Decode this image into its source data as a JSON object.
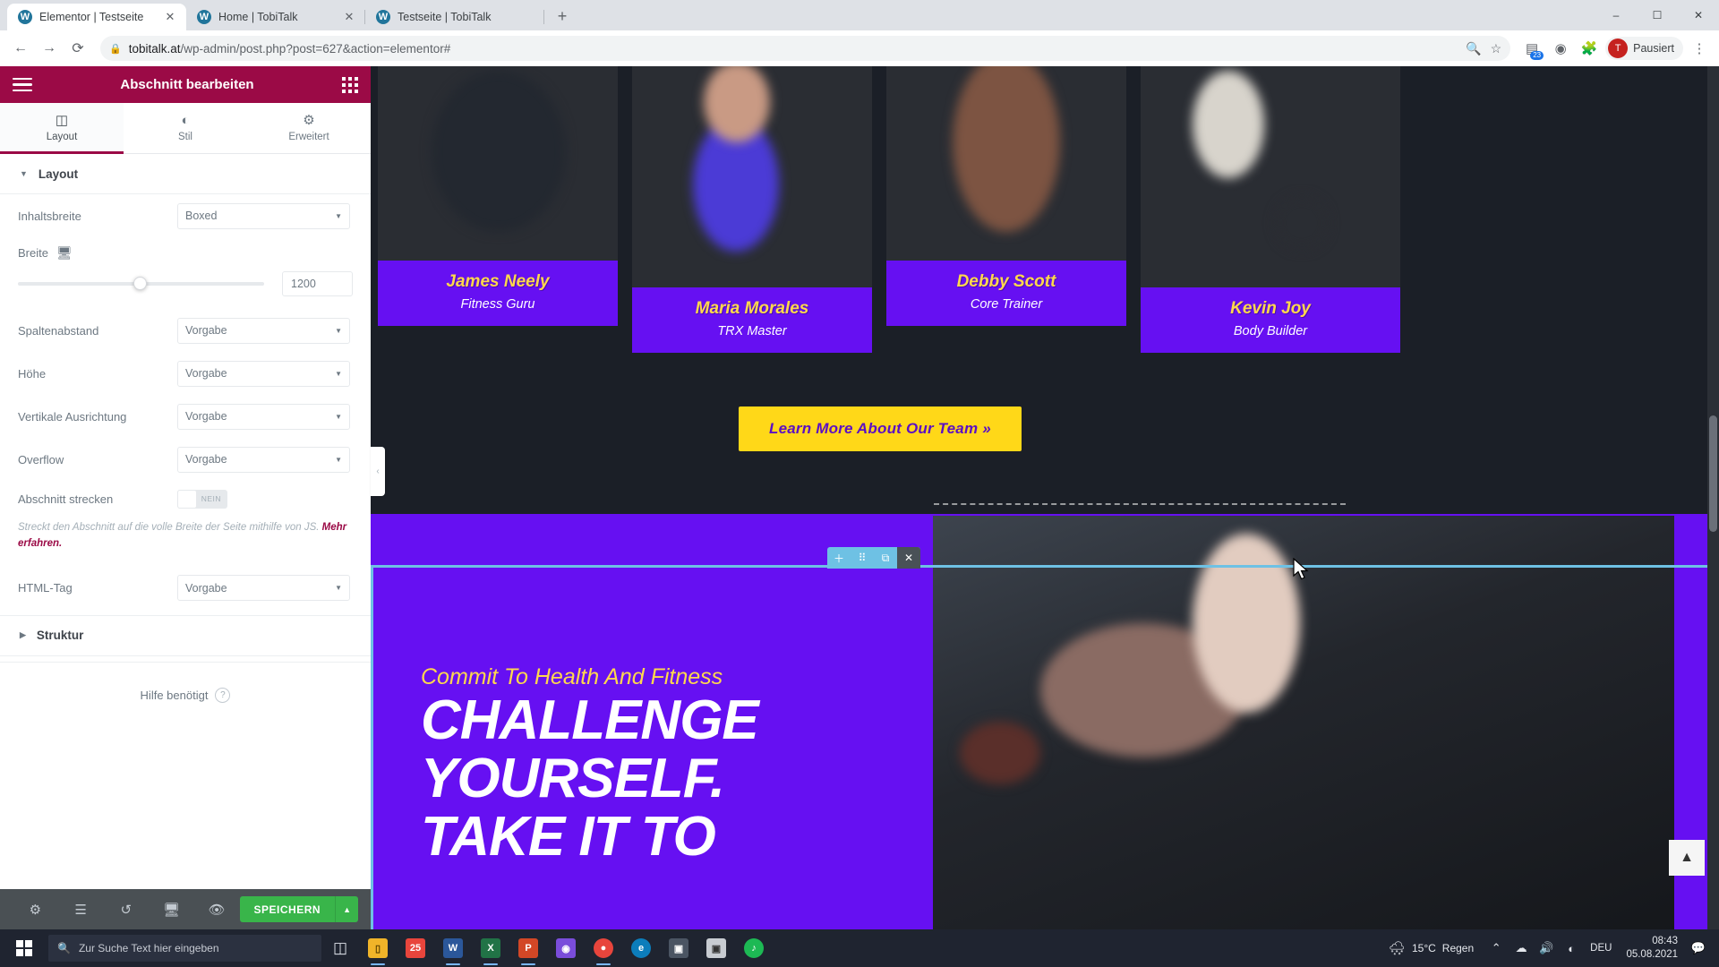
{
  "browser": {
    "tabs": [
      {
        "title": "Elementor | Testseite",
        "favicon": "wordpress-icon",
        "active": true,
        "closable": true
      },
      {
        "title": "Home | TobiTalk",
        "favicon": "wordpress-icon",
        "active": false,
        "closable": true
      },
      {
        "title": "Testseite | TobiTalk",
        "favicon": "wordpress-icon",
        "active": false,
        "closable": false
      }
    ],
    "new_tab_label": "+",
    "window_controls": {
      "minimize": "–",
      "maximize": "☐",
      "close": "✕"
    },
    "nav": {
      "back": "←",
      "forward": "→",
      "reload": "⟳"
    },
    "url_domain": "tobitalk.at",
    "url_path": "/wp-admin/post.php?post=627&action=elementor#",
    "lock_icon": "lock-icon",
    "zoom_icon": "zoom-icon",
    "bookmark_icon": "star-icon",
    "extension_badge": "23",
    "profile_label": "Pausiert",
    "profile_initial": "T",
    "menu_icon": "kebab-menu-icon"
  },
  "panel": {
    "title": "Abschnitt bearbeiten",
    "menu_icon": "hamburger-icon",
    "apps_icon": "grid-apps-icon",
    "tabs": [
      {
        "label": "Layout",
        "icon": "columns-icon",
        "active": true
      },
      {
        "label": "Stil",
        "icon": "contrast-icon",
        "active": false
      },
      {
        "label": "Erweitert",
        "icon": "gear-icon",
        "active": false
      }
    ],
    "section_layout": {
      "title": "Layout",
      "expanded": true,
      "controls": [
        {
          "type": "select",
          "label": "Inhaltsbreite",
          "value": "Boxed"
        },
        {
          "type": "slider",
          "label": "Breite",
          "device_icon": "desktop-icon",
          "value": "1200",
          "percent": 47
        },
        {
          "type": "select",
          "label": "Spaltenabstand",
          "value": "Vorgabe"
        },
        {
          "type": "select",
          "label": "Höhe",
          "value": "Vorgabe"
        },
        {
          "type": "select",
          "label": "Vertikale Ausrichtung",
          "value": "Vorgabe"
        },
        {
          "type": "select",
          "label": "Overflow",
          "value": "Vorgabe"
        },
        {
          "type": "toggle",
          "label": "Abschnitt strecken",
          "value": "NEIN"
        }
      ],
      "stretch_description": "Streckt den Abschnitt auf die volle Breite der Seite mithilfe von JS.",
      "stretch_link": "Mehr erfahren.",
      "html_tag": {
        "label": "HTML-Tag",
        "value": "Vorgabe"
      }
    },
    "section_struktur": {
      "title": "Struktur",
      "expanded": false
    },
    "help": {
      "text": "Hilfe benötigt",
      "icon": "question-circle-icon"
    },
    "footer": {
      "icons": [
        {
          "name": "settings-gear-icon"
        },
        {
          "name": "layers-navigator-icon"
        },
        {
          "name": "history-clock-icon"
        },
        {
          "name": "responsive-devices-icon"
        },
        {
          "name": "preview-eye-icon"
        }
      ],
      "save_label": "SPEICHERN",
      "save_caret": "▲",
      "save_color": "#39b54a"
    },
    "collapse_handle": "‹",
    "header_color": "#9b0a46"
  },
  "canvas": {
    "team_cards": [
      {
        "name": "James Neely",
        "role": "Fitness Guru"
      },
      {
        "name": "Maria Morales",
        "role": "TRX Master"
      },
      {
        "name": "Debby Scott",
        "role": "Core Trainer"
      },
      {
        "name": "Kevin Joy",
        "role": "Body Builder"
      }
    ],
    "cta_button": {
      "label": "Learn More About Our Team",
      "arrow": "»",
      "bg": "#ffd818",
      "fg": "#5b0fc4"
    },
    "hero": {
      "eyebrow": "Commit To Health And Fitness",
      "line1": "CHALLENGE",
      "line2": "YOURSELF.",
      "line3": "TAKE IT TO"
    },
    "section_toolbar": {
      "icons": [
        {
          "name": "add-section-icon",
          "glyph": "＋"
        },
        {
          "name": "drag-handle-icon",
          "glyph": "⠿"
        },
        {
          "name": "duplicate-icon",
          "glyph": "⧉"
        },
        {
          "name": "delete-close-icon",
          "glyph": "✕"
        }
      ],
      "accent": "#6ec1e4"
    },
    "scroll_top_icon": "scroll-to-top-icon",
    "accent_purple": "#6610f2"
  },
  "taskbar": {
    "start_icon": "windows-start-icon",
    "search_placeholder": "Zur Suche Text hier eingeben",
    "search_icon": "search-icon",
    "items": [
      {
        "name": "task-view-icon",
        "glyph": "□□"
      },
      {
        "name": "file-explorer-icon",
        "glyph": "📁"
      },
      {
        "name": "calendar-icon",
        "glyph": "25"
      },
      {
        "name": "word-icon",
        "glyph": "W"
      },
      {
        "name": "excel-icon",
        "glyph": "X"
      },
      {
        "name": "powerpoint-icon",
        "glyph": "P"
      },
      {
        "name": "media-icon",
        "glyph": "◉"
      },
      {
        "name": "chrome-icon",
        "glyph": "●"
      },
      {
        "name": "edge-icon",
        "glyph": "e"
      },
      {
        "name": "screenshot-icon",
        "glyph": "⌧"
      },
      {
        "name": "photos-icon",
        "glyph": "▣"
      },
      {
        "name": "spotify-icon",
        "glyph": "♪"
      }
    ],
    "weather": {
      "icon": "rain-cloud-icon",
      "temp": "15°C",
      "text": "Regen"
    },
    "tray": [
      {
        "name": "show-hidden-icons",
        "glyph": "˄"
      },
      {
        "name": "onedrive-icon",
        "glyph": "☁"
      },
      {
        "name": "volume-icon",
        "glyph": "🔊"
      },
      {
        "name": "network-icon",
        "glyph": "◢"
      }
    ],
    "language": "DEU",
    "time": "08:43",
    "date": "05.08.2021",
    "notification_icon": "notification-bell-icon"
  }
}
